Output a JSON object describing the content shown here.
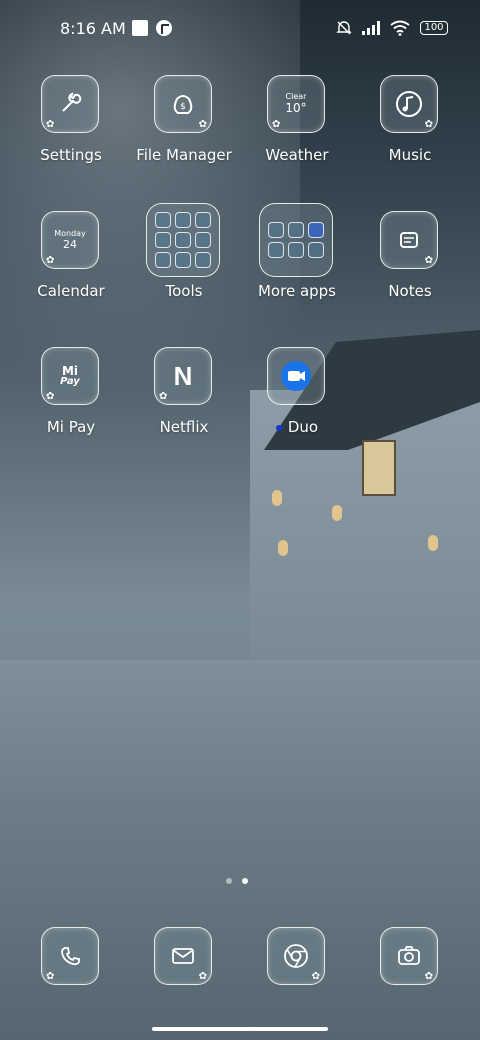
{
  "status_bar": {
    "time": "8:16 AM",
    "battery": "100",
    "icons": [
      "notification-square-icon",
      "r-app-icon",
      "mute-icon",
      "signal-icon",
      "wifi-icon",
      "battery-icon"
    ]
  },
  "apps": {
    "settings": {
      "label": "Settings",
      "icon": "wrench-icon"
    },
    "file_manager": {
      "label": "File Manager",
      "icon": "folder-bag-icon"
    },
    "weather": {
      "label": "Weather",
      "icon": "weather-icon",
      "condition": "Clear",
      "temp": "10°"
    },
    "music": {
      "label": "Music",
      "icon": "music-note-icon"
    },
    "calendar": {
      "label": "Calendar",
      "icon": "calendar-icon",
      "day": "Monday",
      "date": "24"
    },
    "tools": {
      "label": "Tools",
      "icon": "folder-icon"
    },
    "more_apps": {
      "label": "More apps",
      "icon": "folder-icon"
    },
    "notes": {
      "label": "Notes",
      "icon": "notes-icon"
    },
    "mi_pay": {
      "label": "Mi Pay",
      "icon": "mi-pay-icon",
      "glyph_top": "Mi",
      "glyph_bottom": "Pay"
    },
    "netflix": {
      "label": "Netflix",
      "icon": "netflix-icon",
      "glyph": "N"
    },
    "duo": {
      "label": "Duo",
      "icon": "video-camera-icon",
      "accent": "#1a73e8"
    }
  },
  "dock": {
    "items": [
      {
        "icon": "phone-icon"
      },
      {
        "icon": "messages-icon"
      },
      {
        "icon": "chrome-icon"
      },
      {
        "icon": "camera-icon"
      }
    ]
  },
  "page_indicator": {
    "count": 2,
    "active": 2
  },
  "colors": {
    "icon_border": "#ffffff",
    "duo_dot": "#1736d6"
  }
}
